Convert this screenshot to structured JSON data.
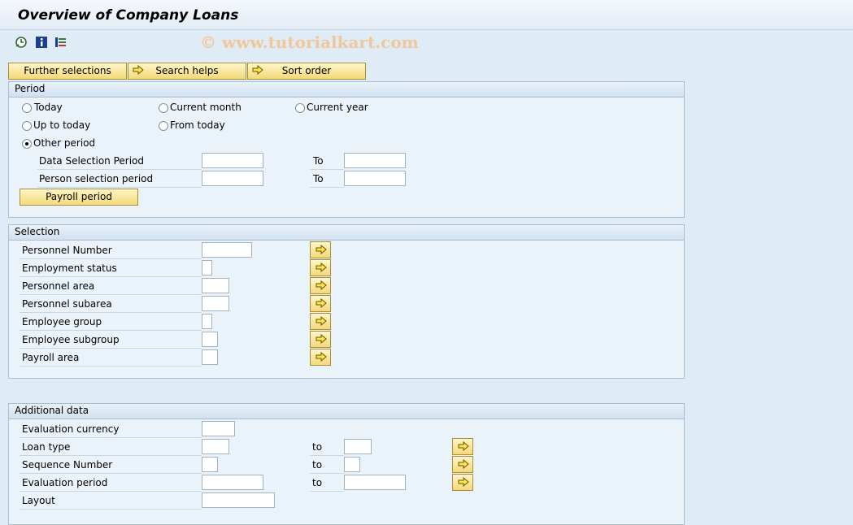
{
  "window": {
    "title": "Overview of Company Loans"
  },
  "toolbar": {
    "icons": [
      "execute-icon",
      "info-icon",
      "variant-icon"
    ],
    "watermark": "© www.tutorialkart.com"
  },
  "top_buttons": {
    "further": "Further selections",
    "search": "Search helps",
    "sort": "Sort order"
  },
  "period": {
    "header": "Period",
    "today": "Today",
    "current_month": "Current month",
    "current_year": "Current year",
    "up_to_today": "Up to today",
    "from_today": "From today",
    "other_period": "Other period",
    "data_sel": "Data Selection Period",
    "person_sel": "Person selection period",
    "to": "To",
    "payroll_btn": "Payroll period",
    "selected": "Other period"
  },
  "selection": {
    "header": "Selection",
    "rows": [
      "Personnel Number",
      "Employment status",
      "Personnel area",
      "Personnel subarea",
      "Employee group",
      "Employee subgroup",
      "Payroll area"
    ]
  },
  "additional": {
    "header": "Additional data",
    "eval_currency": "Evaluation currency",
    "loan_type": "Loan type",
    "seq_number": "Sequence Number",
    "eval_period": "Evaluation period",
    "layout": "Layout",
    "to": "to"
  },
  "colors": {
    "button_face": "#f3d97a",
    "background": "#dfebf5",
    "group_bg": "#ebf3fa"
  }
}
